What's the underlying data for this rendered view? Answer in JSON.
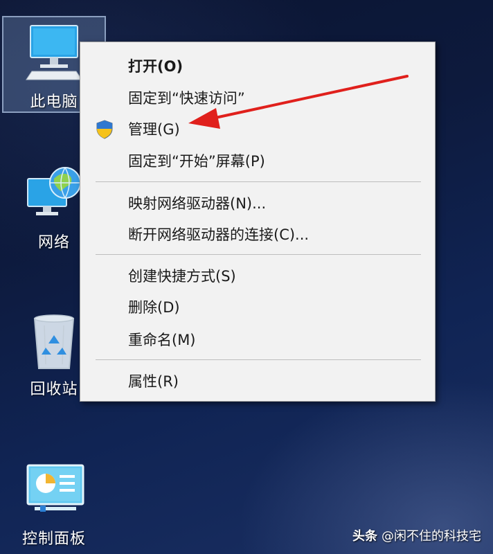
{
  "desktop": {
    "icons": [
      {
        "label": "此电脑"
      },
      {
        "label": "网络"
      },
      {
        "label": "回收站"
      },
      {
        "label": "控制面板"
      }
    ]
  },
  "context_menu": {
    "items": [
      {
        "label": "打开(O)"
      },
      {
        "label": "固定到“快速访问”"
      },
      {
        "label": "管理(G)"
      },
      {
        "label": "固定到“开始”屏幕(P)"
      },
      {
        "label": "映射网络驱动器(N)..."
      },
      {
        "label": "断开网络驱动器的连接(C)..."
      },
      {
        "label": "创建快捷方式(S)"
      },
      {
        "label": "删除(D)"
      },
      {
        "label": "重命名(M)"
      },
      {
        "label": "属性(R)"
      }
    ]
  },
  "watermark": {
    "brand": "头条",
    "author": "@闲不住的科技宅"
  },
  "colors": {
    "annotation_arrow": "#e0201c",
    "menu_background": "#f2f2f2"
  },
  "icons": {
    "admin": "uac-shield-icon"
  }
}
